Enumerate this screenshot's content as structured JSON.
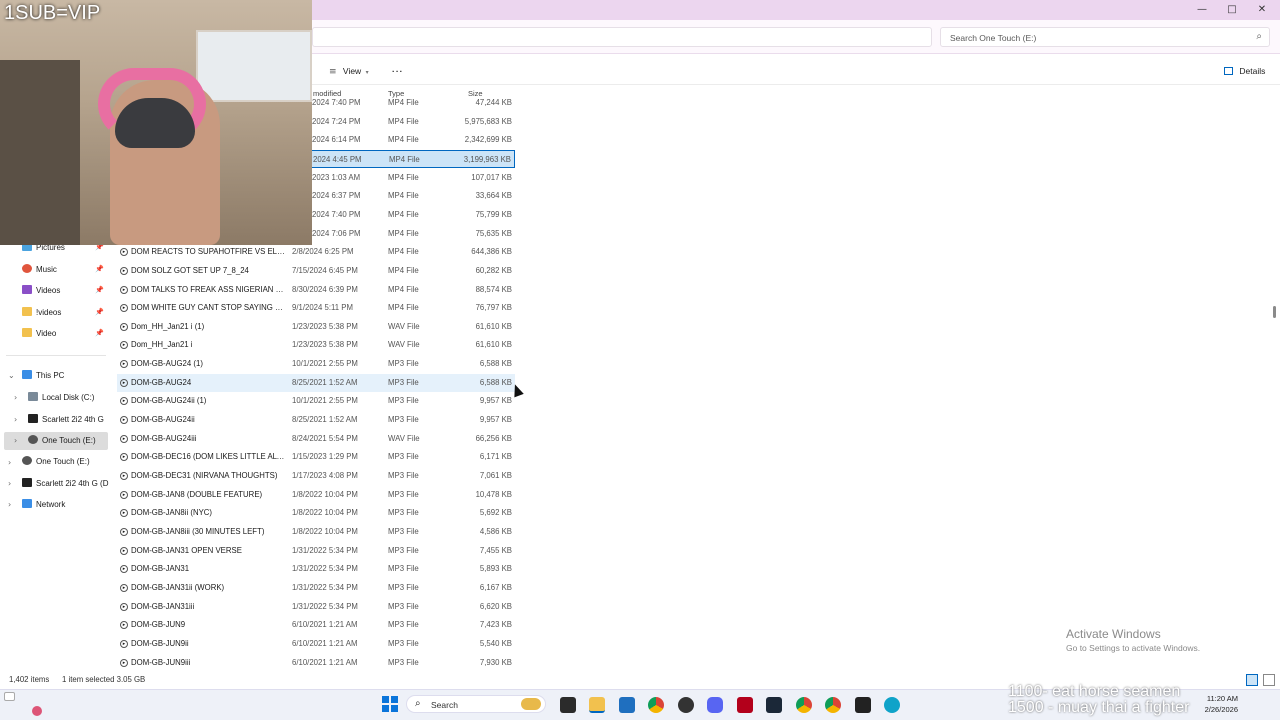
{
  "window": {
    "search_placeholder": "Search One Touch (E:)",
    "minimize": "—",
    "maximize": "□",
    "close": "✕"
  },
  "toolbar": {
    "view_label": "View",
    "more_label": "···",
    "details_label": "Details"
  },
  "columns": {
    "modified": "modified",
    "type": "Type",
    "size": "Size"
  },
  "webcam": {
    "caption": "1SUB=VIP"
  },
  "sidebar": {
    "quick": [
      {
        "label": "Pictures",
        "icon": "pictures-icon"
      },
      {
        "label": "Music",
        "icon": "music-icon"
      },
      {
        "label": "Videos",
        "icon": "videos-icon"
      },
      {
        "label": "!videos",
        "icon": "folder-icon"
      },
      {
        "label": "Video",
        "icon": "folder-icon"
      }
    ],
    "tree": [
      {
        "label": "This PC"
      },
      {
        "label": "Local Disk (C:)"
      },
      {
        "label": "Scarlett 2i2 4th G"
      },
      {
        "label": "One Touch (E:)"
      },
      {
        "label": "One Touch (E:)"
      },
      {
        "label": "Scarlett 2i2 4th G (D"
      },
      {
        "label": "Network"
      }
    ]
  },
  "files": [
    {
      "name": "",
      "date": "2024 7:40 PM",
      "type": "MP4 File",
      "size": "47,244 KB"
    },
    {
      "name": "",
      "date": "2024 7:24 PM",
      "type": "MP4 File",
      "size": "5,975,683 KB"
    },
    {
      "name": "",
      "date": "2024 6:14 PM",
      "type": "MP4 File",
      "size": "2,342,699 KB"
    },
    {
      "name": "",
      "date": "2024 4:45 PM",
      "type": "MP4 File",
      "size": "3,199,963 KB"
    },
    {
      "name": "",
      "date": "2023 1:03 AM",
      "type": "MP4 File",
      "size": "107,017 KB"
    },
    {
      "name": "",
      "date": "2024 6:37 PM",
      "type": "MP4 File",
      "size": "33,664 KB"
    },
    {
      "name": "",
      "date": "2024 7:40 PM",
      "type": "MP4 File",
      "size": "75,799 KB"
    },
    {
      "name": "",
      "date": "2024 7:06 PM",
      "type": "MP4 File",
      "size": "75,635 KB"
    },
    {
      "name": "DOM REACTS TO SUPAHOTFIRE VS ELI M...",
      "date": "2/8/2024 6:25 PM",
      "type": "MP4 File",
      "size": "644,386 KB"
    },
    {
      "name": "DOM SOLZ GOT SET UP 7_8_24",
      "date": "7/15/2024 6:45 PM",
      "type": "MP4 File",
      "size": "60,282 KB"
    },
    {
      "name": "DOM TALKS TO FREAK ASS NIGERIAN NI...",
      "date": "8/30/2024 6:39 PM",
      "type": "MP4 File",
      "size": "88,574 KB"
    },
    {
      "name": "DOM WHITE GUY CANT STOP SAYING NI...",
      "date": "9/1/2024 5:11 PM",
      "type": "MP4 File",
      "size": "76,797 KB"
    },
    {
      "name": "Dom_HH_Jan21 i (1)",
      "date": "1/23/2023 5:38 PM",
      "type": "WAV File",
      "size": "61,610 KB"
    },
    {
      "name": "Dom_HH_Jan21 i",
      "date": "1/23/2023 5:38 PM",
      "type": "WAV File",
      "size": "61,610 KB"
    },
    {
      "name": "DOM-GB-AUG24 (1)",
      "date": "10/1/2021 2:55 PM",
      "type": "MP3 File",
      "size": "6,588 KB"
    },
    {
      "name": "DOM-GB-AUG24",
      "date": "8/25/2021 1:52 AM",
      "type": "MP3 File",
      "size": "6,588 KB"
    },
    {
      "name": "DOM-GB-AUG24ii (1)",
      "date": "10/1/2021 2:55 PM",
      "type": "MP3 File",
      "size": "9,957 KB"
    },
    {
      "name": "DOM-GB-AUG24ii",
      "date": "8/25/2021 1:52 AM",
      "type": "MP3 File",
      "size": "9,957 KB"
    },
    {
      "name": "DOM-GB-AUG24iii",
      "date": "8/24/2021 5:54 PM",
      "type": "WAV File",
      "size": "66,256 KB"
    },
    {
      "name": "DOM-GB-DEC16 (DOM LIKES LITTLE ALT...",
      "date": "1/15/2023 1:29 PM",
      "type": "MP3 File",
      "size": "6,171 KB"
    },
    {
      "name": "DOM-GB-DEC31 (NIRVANA THOUGHTS)",
      "date": "1/17/2023 4:08 PM",
      "type": "MP3 File",
      "size": "7,061 KB"
    },
    {
      "name": "DOM-GB-JAN8 (DOUBLE FEATURE)",
      "date": "1/8/2022 10:04 PM",
      "type": "MP3 File",
      "size": "10,478 KB"
    },
    {
      "name": "DOM-GB-JAN8ii (NYC)",
      "date": "1/8/2022 10:04 PM",
      "type": "MP3 File",
      "size": "5,692 KB"
    },
    {
      "name": "DOM-GB-JAN8iii (30 MINUTES LEFT)",
      "date": "1/8/2022 10:04 PM",
      "type": "MP3 File",
      "size": "4,586 KB"
    },
    {
      "name": "DOM-GB-JAN31 OPEN VERSE",
      "date": "1/31/2022 5:34 PM",
      "type": "MP3 File",
      "size": "7,455 KB"
    },
    {
      "name": "DOM-GB-JAN31",
      "date": "1/31/2022 5:34 PM",
      "type": "MP3 File",
      "size": "5,893 KB"
    },
    {
      "name": "DOM-GB-JAN31ii (WORK)",
      "date": "1/31/2022 5:34 PM",
      "type": "MP3 File",
      "size": "6,167 KB"
    },
    {
      "name": "DOM-GB-JAN31iii",
      "date": "1/31/2022 5:34 PM",
      "type": "MP3 File",
      "size": "6,620 KB"
    },
    {
      "name": "DOM-GB-JUN9",
      "date": "6/10/2021 1:21 AM",
      "type": "MP3 File",
      "size": "7,423 KB"
    },
    {
      "name": "DOM-GB-JUN9ii",
      "date": "6/10/2021 1:21 AM",
      "type": "MP3 File",
      "size": "5,540 KB"
    },
    {
      "name": "DOM-GB-JUN9iii",
      "date": "6/10/2021 1:21 AM",
      "type": "MP3 File",
      "size": "7,930 KB"
    }
  ],
  "status": {
    "items": "1,402 items",
    "selected": "1 item selected  3.05 GB"
  },
  "watermark": {
    "title": "Activate Windows",
    "subtitle": "Go to Settings to activate Windows."
  },
  "overlay": {
    "line1": "1100- eat horse seamen",
    "line2": "1500 - muay thai a fighter"
  },
  "taskbar": {
    "search_label": "Search",
    "time": "11:20 AM",
    "date": "2/26/2026"
  }
}
